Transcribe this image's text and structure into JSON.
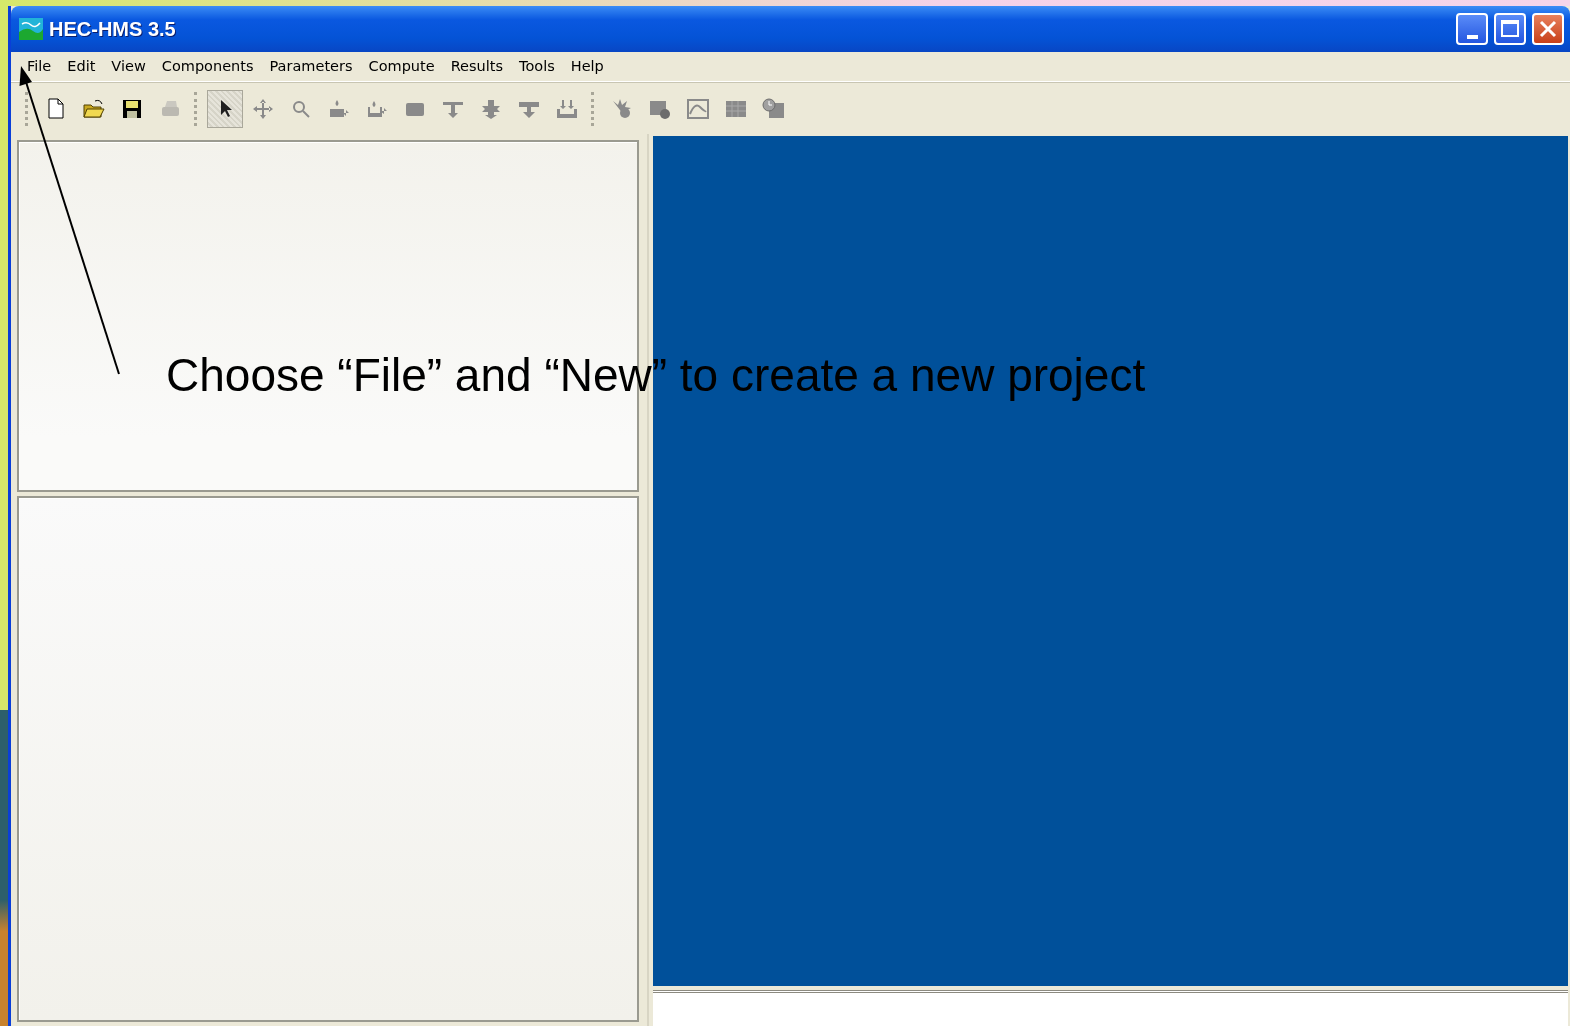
{
  "window": {
    "title": "HEC-HMS 3.5"
  },
  "menu": [
    {
      "label": "File"
    },
    {
      "label": "Edit"
    },
    {
      "label": "View"
    },
    {
      "label": "Components"
    },
    {
      "label": "Parameters"
    },
    {
      "label": "Compute"
    },
    {
      "label": "Results"
    },
    {
      "label": "Tools"
    },
    {
      "label": "Help"
    }
  ],
  "toolbar": {
    "groups": [
      {
        "buttons": [
          {
            "selected": false,
            "disabled": false
          },
          {
            "selected": false,
            "disabled": false
          },
          {
            "selected": false,
            "disabled": false
          },
          {
            "selected": false,
            "disabled": true
          }
        ]
      },
      {
        "buttons": [
          {
            "selected": true,
            "disabled": false
          },
          {
            "selected": false,
            "disabled": true
          },
          {
            "selected": false,
            "disabled": true
          },
          {
            "selected": false,
            "disabled": true
          },
          {
            "selected": false,
            "disabled": true
          },
          {
            "selected": false,
            "disabled": true
          },
          {
            "selected": false,
            "disabled": true
          },
          {
            "selected": false,
            "disabled": true
          },
          {
            "selected": false,
            "disabled": true
          },
          {
            "selected": false,
            "disabled": true
          }
        ]
      },
      {
        "buttons": [
          {
            "selected": false,
            "disabled": true
          },
          {
            "selected": false,
            "disabled": true
          },
          {
            "selected": false,
            "disabled": true
          },
          {
            "selected": false,
            "disabled": true
          },
          {
            "selected": false,
            "disabled": true
          }
        ]
      }
    ]
  },
  "annotation": {
    "text": "Choose “File” and “New” to create a new project"
  }
}
